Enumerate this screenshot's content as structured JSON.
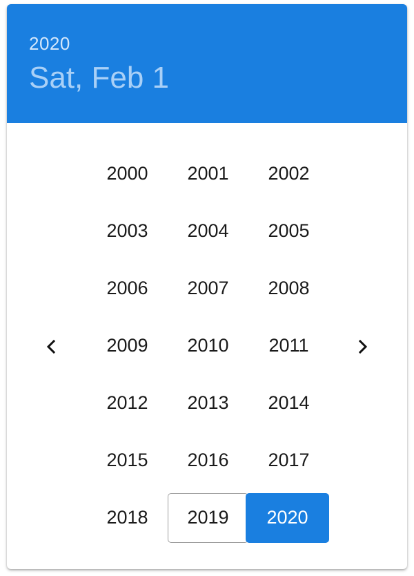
{
  "header": {
    "year": "2020",
    "date": "Sat, Feb 1"
  },
  "nav": {
    "prev_icon": "chevron-left-icon",
    "next_icon": "chevron-right-icon"
  },
  "years": [
    "2000",
    "2001",
    "2002",
    "2003",
    "2004",
    "2005",
    "2006",
    "2007",
    "2008",
    "2009",
    "2010",
    "2011",
    "2012",
    "2013",
    "2014",
    "2015",
    "2016",
    "2017",
    "2018",
    "2019",
    "2020"
  ],
  "focused_year": "2019",
  "selected_year": "2020",
  "colors": {
    "accent": "#1a7fe0"
  }
}
